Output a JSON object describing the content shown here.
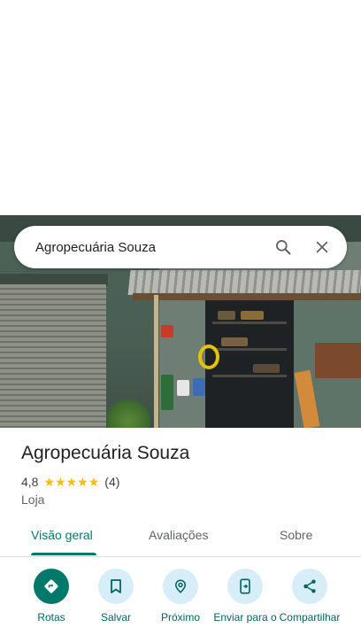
{
  "search": {
    "value": "Agropecuária Souza",
    "search_icon": "search-icon",
    "close_icon": "close-icon"
  },
  "place": {
    "title": "Agropecuária Souza",
    "rating": "4,8",
    "stars": 5,
    "review_count": "(4)",
    "category": "Loja"
  },
  "tabs": [
    {
      "label": "Visão geral",
      "active": true
    },
    {
      "label": "Avaliações",
      "active": false
    },
    {
      "label": "Sobre",
      "active": false
    }
  ],
  "actions": [
    {
      "label": "Rotas",
      "icon": "directions-icon"
    },
    {
      "label": "Salvar",
      "icon": "bookmark-icon"
    },
    {
      "label": "Próximo",
      "icon": "nearby-icon"
    },
    {
      "label": "Enviar para o",
      "icon": "send-to-phone-icon"
    },
    {
      "label": "Compartilhar",
      "icon": "share-icon"
    }
  ],
  "colors": {
    "accent": "#00796b",
    "action_bg": "#d7eef8",
    "star": "#fbbc04"
  }
}
